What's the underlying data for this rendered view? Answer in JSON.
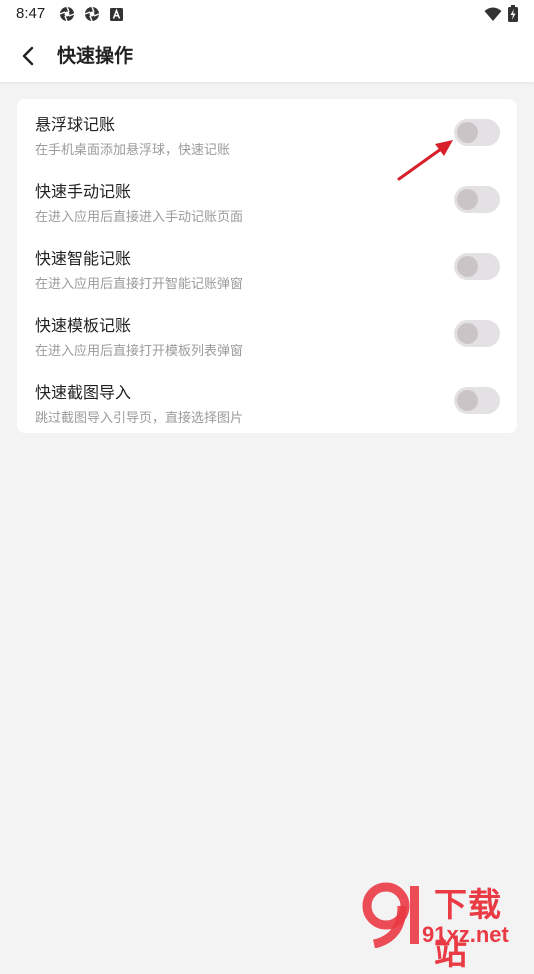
{
  "status_bar": {
    "time": "8:47",
    "left_icons": [
      "aperture-icon",
      "aperture-icon",
      "a-square-icon"
    ],
    "right_icons": [
      "wifi-icon",
      "battery-charging-icon"
    ]
  },
  "header": {
    "back_icon": "chevron-left-icon",
    "title": "快速操作"
  },
  "settings": [
    {
      "title": "悬浮球记账",
      "subtitle": "在手机桌面添加悬浮球，快速记账",
      "enabled": false
    },
    {
      "title": "快速手动记账",
      "subtitle": "在进入应用后直接进入手动记账页面",
      "enabled": false
    },
    {
      "title": "快速智能记账",
      "subtitle": "在进入应用后直接打开智能记账弹窗",
      "enabled": false
    },
    {
      "title": "快速模板记账",
      "subtitle": "在进入应用后直接打开模板列表弹窗",
      "enabled": false
    },
    {
      "title": "快速截图导入",
      "subtitle": "跳过截图导入引导页，直接选择图片",
      "enabled": false
    }
  ],
  "annotation": {
    "icon": "red-arrow-icon",
    "color": "#d8202a"
  },
  "watermark": {
    "brand": "下载站",
    "domain": "91xz.net",
    "color": "#ea3a44"
  },
  "colors": {
    "background": "#f3f3f4",
    "card": "#ffffff",
    "toggle_track": "#e3e1e3",
    "toggle_knob": "#cbc4c7"
  }
}
